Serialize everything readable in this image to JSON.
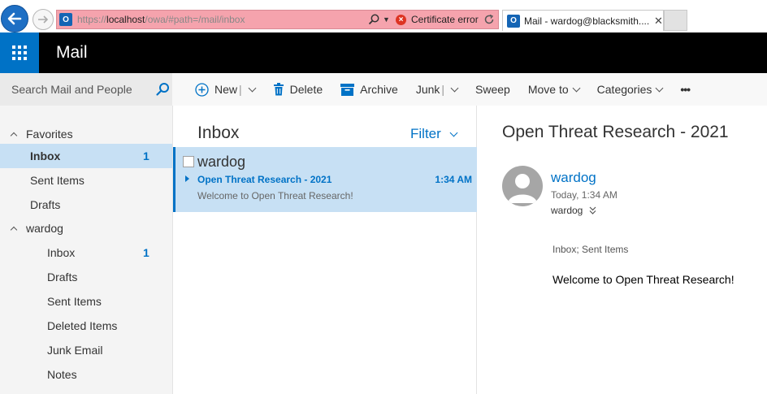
{
  "browser": {
    "url_prefix": "https://",
    "url_host": "localhost",
    "url_path": "/owa/#path=/mail/inbox",
    "cert_error": "Certificate error",
    "tab_title": "Mail - wardog@blacksmith....",
    "tab_close": "✕"
  },
  "suite": {
    "app_title": "Mail"
  },
  "search": {
    "placeholder": "Search Mail and People"
  },
  "commands": {
    "new": "New",
    "delete": "Delete",
    "archive": "Archive",
    "junk": "Junk",
    "sweep": "Sweep",
    "move_to": "Move to",
    "categories": "Categories",
    "more": "•••"
  },
  "folders": {
    "favorites_label": "Favorites",
    "favorites": [
      {
        "label": "Inbox",
        "count": "1"
      },
      {
        "label": "Sent Items",
        "count": ""
      },
      {
        "label": "Drafts",
        "count": ""
      }
    ],
    "account_label": "wardog",
    "account": [
      {
        "label": "Inbox",
        "count": "1"
      },
      {
        "label": "Drafts",
        "count": ""
      },
      {
        "label": "Sent Items",
        "count": ""
      },
      {
        "label": "Deleted Items",
        "count": ""
      },
      {
        "label": "Junk Email",
        "count": ""
      },
      {
        "label": "Notes",
        "count": ""
      }
    ]
  },
  "list": {
    "title": "Inbox",
    "filter": "Filter",
    "messages": [
      {
        "sender": "wardog",
        "subject": "Open Threat Research - 2021",
        "time": "1:34 AM",
        "preview": "Welcome to Open Threat Research!"
      }
    ]
  },
  "reading": {
    "subject": "Open Threat Research - 2021",
    "from": "wardog",
    "date": "Today, 1:34 AM",
    "to": "wardog",
    "folders": "Inbox; Sent Items",
    "body": "Welcome to Open Threat Research!"
  },
  "colors": {
    "accent": "#0072c6",
    "selected_bg": "#c7e0f4",
    "suite_bar": "#000000",
    "cert_error_bar": "#f5a3ad"
  }
}
